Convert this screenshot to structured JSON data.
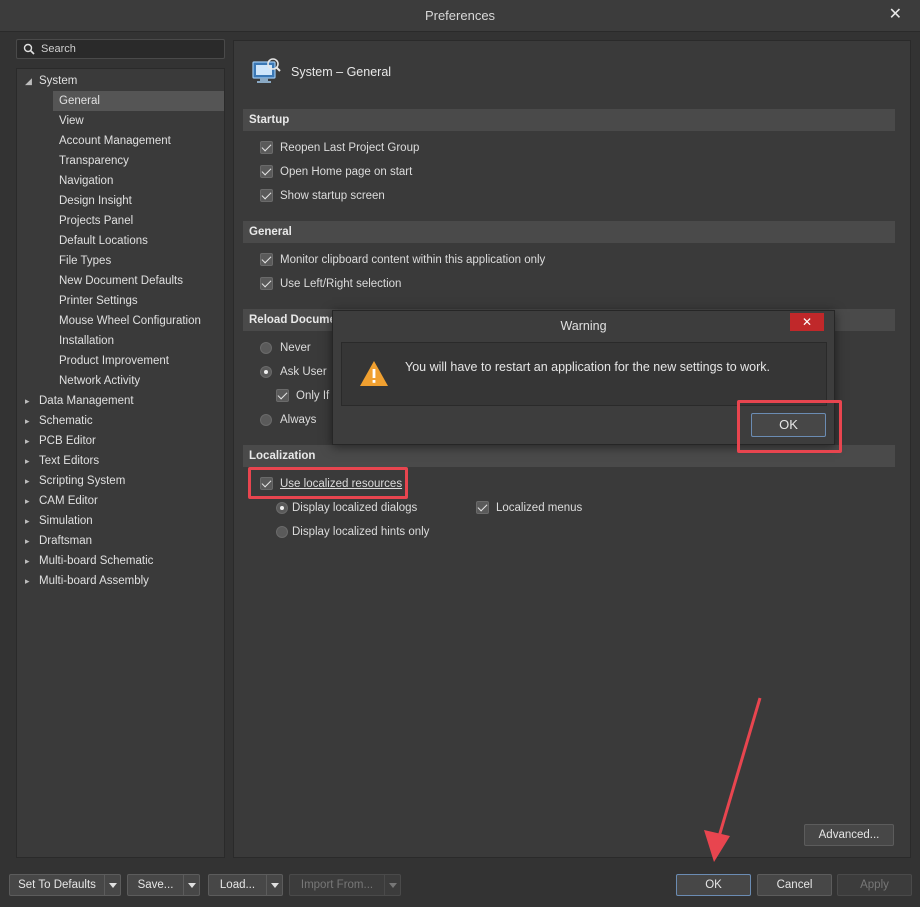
{
  "window": {
    "title": "Preferences",
    "close_glyph": "✕"
  },
  "search": {
    "placeholder": "Search"
  },
  "tree": {
    "root": "System",
    "system_children": [
      "General",
      "View",
      "Account Management",
      "Transparency",
      "Navigation",
      "Design Insight",
      "Projects Panel",
      "Default Locations",
      "File Types",
      "New Document Defaults",
      "Printer Settings",
      "Mouse Wheel Configuration",
      "Installation",
      "Product Improvement",
      "Network Activity"
    ],
    "selected": "General",
    "other_roots": [
      "Data Management",
      "Schematic",
      "PCB Editor",
      "Text Editors",
      "Scripting System",
      "CAM Editor",
      "Simulation",
      "Draftsman",
      "Multi-board Schematic",
      "Multi-board Assembly"
    ]
  },
  "page": {
    "title": "System – General",
    "icon": "system-settings-icon",
    "startup": {
      "header": "Startup",
      "options": [
        "Reopen Last Project Group",
        "Open Home page on start",
        "Show startup screen"
      ]
    },
    "general": {
      "header": "General",
      "options": [
        "Monitor clipboard content within this application only",
        "Use Left/Right selection"
      ]
    },
    "reload": {
      "header": "Reload Documer",
      "never": "Never",
      "ask_user": "Ask User",
      "only_if": "Only If I",
      "always": "Always"
    },
    "localization": {
      "header": "Localization",
      "use_localized": "Use localized resources",
      "display_dialogs": "Display localized dialogs",
      "display_hints": "Display localized hints only",
      "localized_menus": "Localized menus"
    },
    "advanced_label": "Advanced..."
  },
  "warning": {
    "title": "Warning",
    "message": "You will have to restart an application for the new settings to work.",
    "ok": "OK",
    "close_glyph": "✕"
  },
  "footer": {
    "set_defaults": "Set To Defaults",
    "save": "Save...",
    "load": "Load...",
    "import": "Import From...",
    "ok": "OK",
    "cancel": "Cancel",
    "apply": "Apply"
  },
  "colors": {
    "highlight": "#e8454f",
    "warning": "#f0a030",
    "close_red": "#c0282a"
  }
}
